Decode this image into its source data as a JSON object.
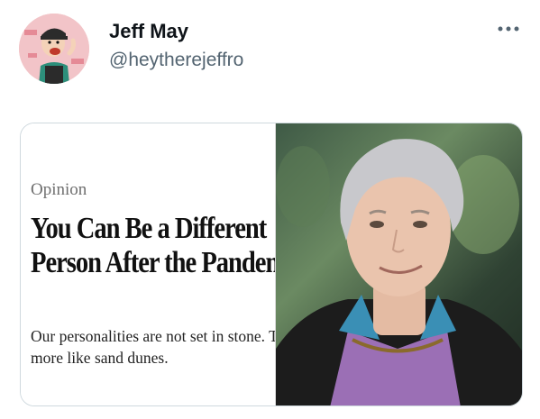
{
  "author": {
    "name": "Jeff May",
    "handle": "@heytherejeffro"
  },
  "more_icon": "more-dots-icon",
  "media": {
    "article": {
      "kicker": "Opinion",
      "headline": "You Can Be a Different Person After the Pandemic",
      "summary": "Our personalities are not set in stone. They are more like sand dunes."
    },
    "photo": {
      "subject": "man-with-silver-hair-photo"
    }
  }
}
